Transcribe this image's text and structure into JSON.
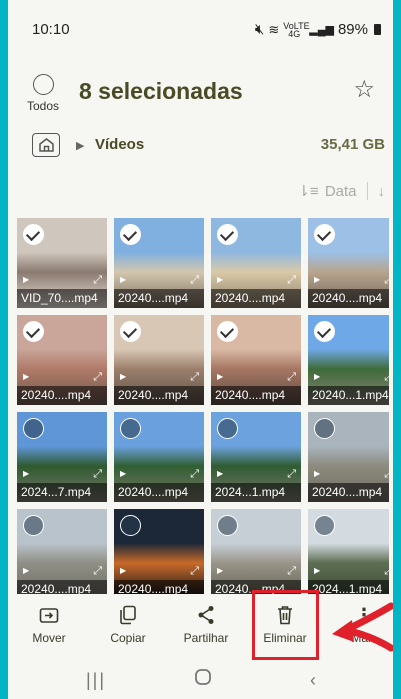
{
  "status": {
    "time": "10:10",
    "signal_text": "VoLTE 4G",
    "battery": "89%"
  },
  "header": {
    "select_all_label": "Todos",
    "title": "8 selecionadas"
  },
  "breadcrumb": {
    "folder": "Vídeos",
    "size": "35,41 GB"
  },
  "sort": {
    "label": "Data"
  },
  "grid": {
    "items": [
      {
        "name": "VID_70....mp4",
        "selected": true,
        "colors": [
          "#cfc7bd",
          "#8a7a70",
          "#e8e0d8"
        ]
      },
      {
        "name": "20240....mp4",
        "selected": true,
        "colors": [
          "#7fb0e0",
          "#d2c6ae",
          "#7a6e5e"
        ]
      },
      {
        "name": "20240....mp4",
        "selected": true,
        "colors": [
          "#8fb8e0",
          "#d9c9a8",
          "#8c7d6a"
        ]
      },
      {
        "name": "20240....mp4",
        "selected": true,
        "colors": [
          "#9cc0e6",
          "#b8a48e",
          "#6e6458"
        ]
      },
      {
        "name": "20240....mp4",
        "selected": true,
        "colors": [
          "#c9a59a",
          "#b07a68",
          "#6e5a4e"
        ]
      },
      {
        "name": "20240....mp4",
        "selected": true,
        "colors": [
          "#d8c7b4",
          "#9b7f6b",
          "#5e5248"
        ]
      },
      {
        "name": "20240....mp4",
        "selected": true,
        "colors": [
          "#d9b9a4",
          "#a67662",
          "#5b4c44"
        ]
      },
      {
        "name": "20240...1.mp4",
        "selected": true,
        "colors": [
          "#6fa8e6",
          "#3f6b3a",
          "#8b8378"
        ]
      },
      {
        "name": "2024...7.mp4",
        "selected": false,
        "colors": [
          "#5f96d8",
          "#2f5a2f",
          "#7a766c"
        ]
      },
      {
        "name": "20240....mp4",
        "selected": false,
        "colors": [
          "#6aa0dd",
          "#315f33",
          "#7c766a"
        ]
      },
      {
        "name": "2024...1.mp4",
        "selected": false,
        "colors": [
          "#6ca2dd",
          "#2f5c31",
          "#7d786e"
        ]
      },
      {
        "name": "20240....mp4",
        "selected": false,
        "colors": [
          "#a9b4bd",
          "#8d8a7e",
          "#6d6a60"
        ]
      },
      {
        "name": "20240....mp4",
        "selected": false,
        "colors": [
          "#b9c3cb",
          "#8f8f86",
          "#6f6e66"
        ]
      },
      {
        "name": "20240....mp4",
        "selected": false,
        "colors": [
          "#1c2838",
          "#c86a2a",
          "#0c1018"
        ]
      },
      {
        "name": "20240....mp4",
        "selected": false,
        "colors": [
          "#c7cfd6",
          "#9a958a",
          "#5e604e"
        ]
      },
      {
        "name": "2024...1.mp4",
        "selected": false,
        "colors": [
          "#d4dbe0",
          "#5d6e52",
          "#3c4b36"
        ]
      }
    ]
  },
  "actions": [
    {
      "label": "Mover",
      "icon": "move-icon"
    },
    {
      "label": "Copiar",
      "icon": "copy-icon"
    },
    {
      "label": "Partilhar",
      "icon": "share-icon"
    },
    {
      "label": "Eliminar",
      "icon": "trash-icon"
    },
    {
      "label": "Mais",
      "icon": "more-icon"
    }
  ],
  "colors": {
    "accent_highlight": "#e0202a",
    "title": "#4a4a24"
  }
}
